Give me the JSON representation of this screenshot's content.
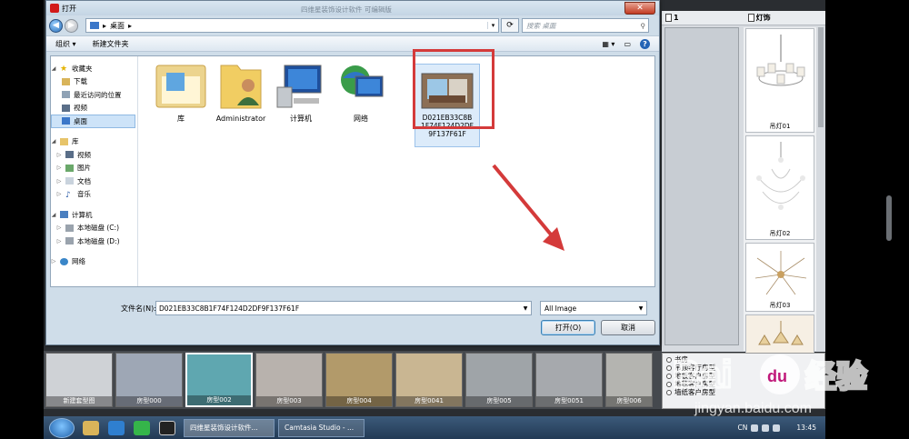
{
  "dialog": {
    "title": "打开",
    "center_title": "四维星装饰设计软件 可编辑版",
    "breadcrumb": "桌面",
    "search_placeholder": "搜索 桌面",
    "toolbar": {
      "organize": "组织 ▾",
      "new_folder": "新建文件夹"
    },
    "nav": {
      "favorites": {
        "label": "收藏夹",
        "items": [
          "下载",
          "最近访问的位置",
          "视频",
          "桌面"
        ]
      },
      "libraries": {
        "label": "库",
        "items": [
          "视频",
          "图片",
          "文档",
          "音乐"
        ]
      },
      "computer": {
        "label": "计算机",
        "items": [
          "本地磁盘 (C:)",
          "本地磁盘 (D:)"
        ]
      },
      "network": {
        "label": "网络"
      }
    },
    "files": [
      {
        "label": "库",
        "icon": "library-folder-icon"
      },
      {
        "label": "Administrator",
        "icon": "user-folder-icon"
      },
      {
        "label": "计算机",
        "icon": "computer-icon"
      },
      {
        "label": "网络",
        "icon": "network-icon"
      },
      {
        "label": "D021EB33C8B1F74F124D2DF9F137F61F",
        "icon": "image-file-icon",
        "label_lines": [
          "D021EB33C8B",
          "1F74F124D2DF",
          "9F137F61F"
        ]
      }
    ],
    "filename_label": "文件名(N):",
    "filename_value": "D021EB33C8B1F74F124D2DF9F137F61F",
    "filetype_value": "All Image",
    "open_button": "打开(O)",
    "cancel_button": "取消"
  },
  "right_panel": {
    "tab1": "1",
    "tab2": "灯饰",
    "lamps": [
      "吊灯01",
      "吊灯02",
      "吊灯03"
    ]
  },
  "rooms": [
    {
      "label": "新建套型图",
      "color": "#cfd2d6"
    },
    {
      "label": "房型000",
      "color": "#9ea7b5"
    },
    {
      "label": "房型002",
      "color": "#5fa7b0"
    },
    {
      "label": "房型003",
      "color": "#b8b2ad"
    },
    {
      "label": "房型004",
      "color": "#b29a6a"
    },
    {
      "label": "房型0041",
      "color": "#c9b692"
    },
    {
      "label": "房型005",
      "color": "#9fa4a8"
    },
    {
      "label": "房型0051",
      "color": "#a6a9ad"
    },
    {
      "label": "房型006",
      "color": "#b4b4b0"
    }
  ],
  "options": [
    "书房",
    "吊顶客厅房型",
    "地板客户房型",
    "地毯客户房型",
    "墙纸客户房型"
  ],
  "taskbar": {
    "task1": "四维星装饰设计软件...",
    "task2": "Camtasia Studio - ...",
    "tray_lang": "CN",
    "time": "13:45"
  },
  "watermark": {
    "brand": "Bai",
    "brand2": "du",
    "suffix": "经验",
    "url": "jingyan.baidu.com"
  },
  "colors": {
    "accent_red": "#d43a3a",
    "dialog_bg": "#cfdde9"
  }
}
